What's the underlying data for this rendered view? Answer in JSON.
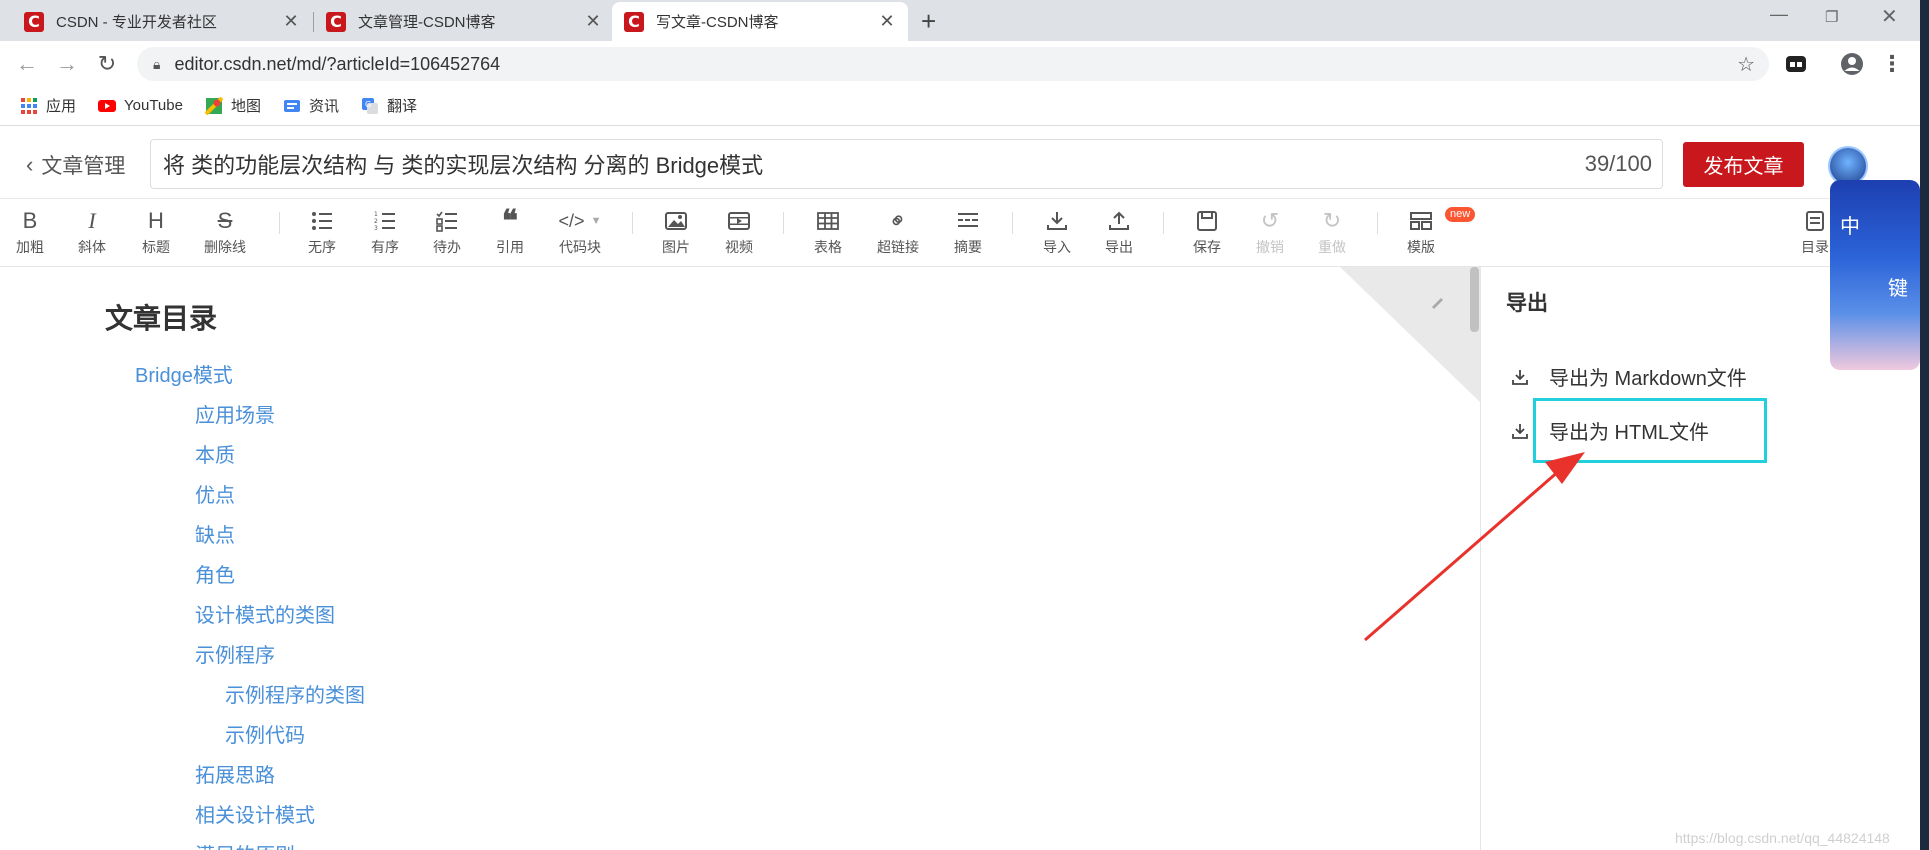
{
  "browser": {
    "tabs": [
      {
        "title": "CSDN - 专业开发者社区",
        "active": false
      },
      {
        "title": "文章管理-CSDN博客",
        "active": false
      },
      {
        "title": "写文章-CSDN博客",
        "active": true
      }
    ],
    "new_tab": "+",
    "url": "editor.csdn.net/md/?articleId=106452764",
    "bookmarks": [
      "应用",
      "YouTube",
      "地图",
      "资讯",
      "翻译"
    ]
  },
  "editor": {
    "back_label": "文章管理",
    "title": "将  类的功能层次结构  与  类的实现层次结构  分离的  Bridge模式",
    "title_count": "39/100",
    "publish_label": "发布文章",
    "toolbar": {
      "bold": "加粗",
      "italic": "斜体",
      "heading": "标题",
      "strike": "删除线",
      "ul": "无序",
      "ol": "有序",
      "todo": "待办",
      "quote": "引用",
      "code": "代码块",
      "image": "图片",
      "video": "视频",
      "table": "表格",
      "link": "超链接",
      "summary": "摘要",
      "import": "导入",
      "export": "导出",
      "save": "保存",
      "undo": "撤销",
      "redo": "重做",
      "template": "模版",
      "template_badge": "new",
      "toc": "目录"
    },
    "toolbar_glyphs": {
      "bold": "B",
      "italic": "I",
      "heading": "H",
      "strike": "S"
    }
  },
  "toc": {
    "title": "文章目录",
    "items": [
      {
        "text": "Bridge模式",
        "level": 1
      },
      {
        "text": "应用场景",
        "level": 2
      },
      {
        "text": "本质",
        "level": 2
      },
      {
        "text": "优点",
        "level": 2
      },
      {
        "text": "缺点",
        "level": 2
      },
      {
        "text": "角色",
        "level": 2
      },
      {
        "text": "设计模式的类图",
        "level": 2
      },
      {
        "text": "示例程序",
        "level": 2
      },
      {
        "text": "示例程序的类图",
        "level": 3
      },
      {
        "text": "示例代码",
        "level": 3
      },
      {
        "text": "拓展思路",
        "level": 2
      },
      {
        "text": "相关设计模式",
        "level": 2
      },
      {
        "text": "满足的原则",
        "level": 2
      }
    ]
  },
  "export_panel": {
    "title": "导出",
    "options": [
      "导出为 Markdown文件",
      "导出为 HTML文件"
    ],
    "highlighted": "导出为 HTML文件"
  },
  "sticker_chars": [
    "中",
    "键"
  ],
  "watermark": "https://blog.csdn.net/qq_44824148",
  "colors": {
    "brand_red": "#c9181d",
    "link_blue": "#4a90d9",
    "highlight_cyan": "#22d0dd",
    "arrow_red": "#e8322b"
  }
}
